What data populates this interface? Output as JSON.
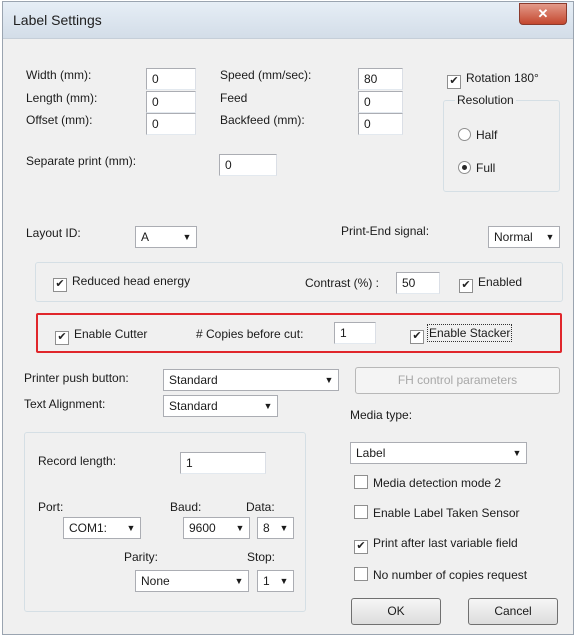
{
  "window": {
    "title": "Label Settings",
    "close_glyph": "✕"
  },
  "top": {
    "width_label": "Width (mm):",
    "width_value": "0",
    "length_label": "Length (mm):",
    "length_value": "0",
    "offset_label": "Offset (mm):",
    "offset_value": "0",
    "speed_label": "Speed (mm/sec):",
    "speed_value": "80",
    "feed_label": "Feed",
    "feed_value": "0",
    "backfeed_label": "Backfeed (mm):",
    "backfeed_value": "0",
    "separate_label": "Separate print (mm):",
    "separate_value": "0",
    "rotation_label": "Rotation 180°",
    "rotation_checked": true
  },
  "resolution": {
    "legend": "Resolution",
    "half_label": "Half",
    "full_label": "Full",
    "selected": "Full"
  },
  "layout": {
    "layout_id_label": "Layout ID:",
    "layout_id_value": "A",
    "print_end_label": "Print-End signal:",
    "print_end_value": "Normal"
  },
  "energy": {
    "reduced_label": "Reduced head energy",
    "reduced_checked": true,
    "contrast_label": "Contrast (%) :",
    "contrast_value": "50",
    "enabled_label": "Enabled",
    "enabled_checked": true
  },
  "cutter": {
    "enable_cutter_label": "Enable Cutter",
    "enable_cutter_checked": true,
    "copies_label": "# Copies before cut:",
    "copies_value": "1",
    "stacker_label": "Enable Stacker",
    "stacker_checked": true,
    "highlight_color": "#e0262b"
  },
  "printer": {
    "push_button_label": "Printer push button:",
    "push_button_value": "Standard",
    "fh_button_label": "FH control parameters",
    "text_align_label": "Text Alignment:",
    "text_align_value": "Standard"
  },
  "record": {
    "record_length_label": "Record length:",
    "record_length_value": "1",
    "port_label": "Port:",
    "port_value": "COM1:",
    "baud_label": "Baud:",
    "baud_value": "9600",
    "data_label": "Data:",
    "data_value": "8",
    "parity_label": "Parity:",
    "parity_value": "None",
    "stop_label": "Stop:",
    "stop_value": "1"
  },
  "media": {
    "media_type_label": "Media type:",
    "media_type_value": "Label",
    "detection_label": "Media detection mode 2",
    "detection_checked": false,
    "taken_sensor_label": "Enable Label Taken Sensor",
    "taken_sensor_checked": false,
    "print_after_label": "Print after last variable field",
    "print_after_checked": true,
    "no_copies_label": "No number of copies request",
    "no_copies_checked": false
  },
  "buttons": {
    "ok_label": "OK",
    "cancel_label": "Cancel"
  },
  "icons": {
    "dropdown_arrow": "▼",
    "check_mark": "✔"
  }
}
